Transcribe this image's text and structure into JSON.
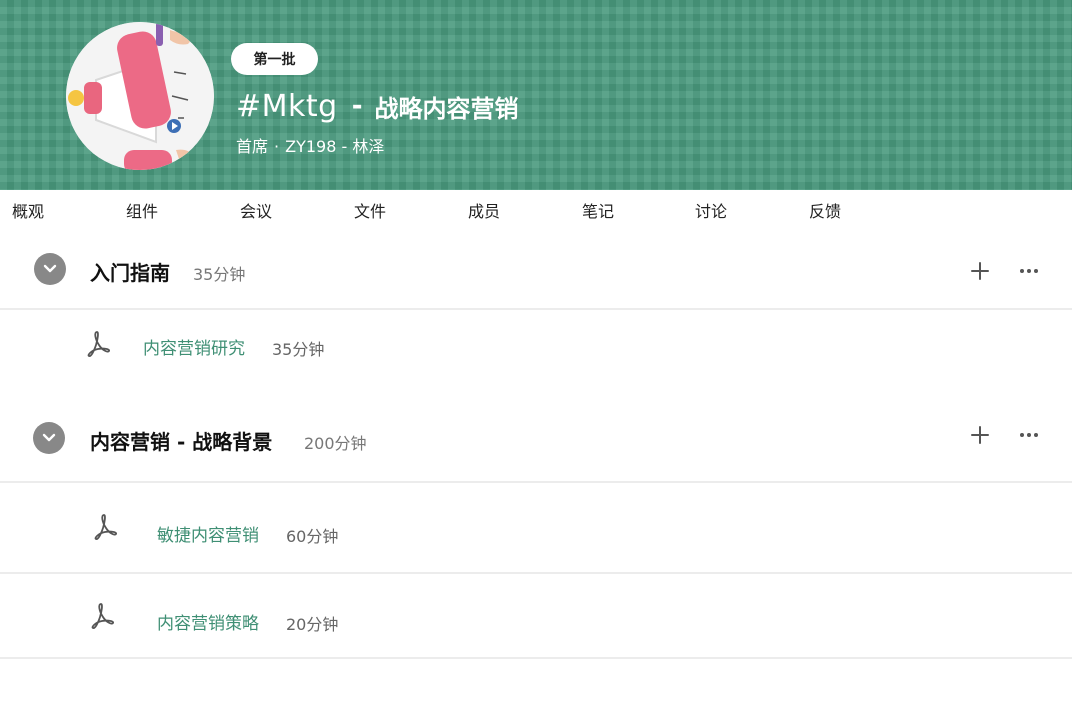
{
  "header": {
    "batch_badge": "第一批",
    "course_code": "#Mktg",
    "separator": "-",
    "course_name": "战略内容营销",
    "meta_role": "首席",
    "meta_dot": "·",
    "meta_instructor": "ZY198 - 林泽",
    "banner_color": "#4a9a7e"
  },
  "nav": {
    "items": [
      {
        "label": "概观"
      },
      {
        "label": "组件"
      },
      {
        "label": "会议"
      },
      {
        "label": "文件"
      },
      {
        "label": "成员"
      },
      {
        "label": "笔记"
      },
      {
        "label": "讨论"
      },
      {
        "label": "反馈"
      }
    ]
  },
  "sections": [
    {
      "title": "入门指南",
      "duration": "35分钟",
      "items": [
        {
          "title": "内容营销研究",
          "duration": "35分钟",
          "icon": "pdf-icon"
        }
      ]
    },
    {
      "title": "内容营销 - 战略背景",
      "duration": "200分钟",
      "items": [
        {
          "title": "敏捷内容营销",
          "duration": "60分钟",
          "icon": "pdf-icon"
        },
        {
          "title": "内容营销策略",
          "duration": "20分钟",
          "icon": "pdf-icon"
        }
      ]
    }
  ],
  "colors": {
    "accent_link": "#3f8f74",
    "toggle_bg": "#888888"
  }
}
